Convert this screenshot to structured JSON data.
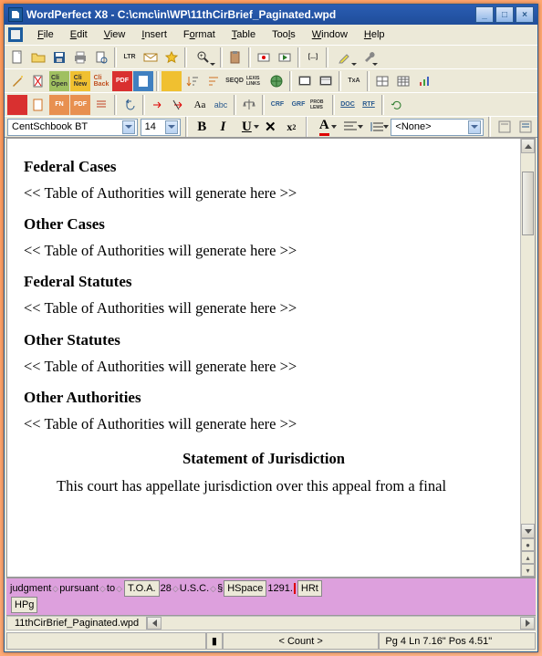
{
  "app": {
    "title": "WordPerfect X8 - C:\\cmc\\in\\WP\\11thCirBrief_Paginated.wpd"
  },
  "menu": {
    "file": "File",
    "edit": "Edit",
    "view": "View",
    "insert": "Insert",
    "format": "Format",
    "table": "Table",
    "tools": "Tools",
    "window": "Window",
    "help": "Help"
  },
  "prop": {
    "font": "CentSchbook BT",
    "size": "14",
    "style_none": "<None>"
  },
  "doc": {
    "h1": "Federal Cases",
    "p1": "<< Table of Authorities will generate here >>",
    "h2": "Other Cases",
    "p2": "<< Table of Authorities will generate here >>",
    "h3": "Federal Statutes",
    "p3": "<< Table of Authorities will generate here >>",
    "h4": "Other Statutes",
    "p4": "<< Table of Authorities will generate here >>",
    "h5": "Other Authorities",
    "p5": "<< Table of Authorities will generate here >>",
    "stmt": "Statement of Jurisdiction",
    "body": "This court has appellate jurisdiction over this appeal from a final"
  },
  "reveal": {
    "w1": "judgment",
    "w2": "pursuant",
    "w3": "to",
    "c1": "T.O.A.",
    "w4": "28",
    "w5": "U.S.C.",
    "w6": "§",
    "c2": "HSpace",
    "w7": "1291.",
    "c3": "HRt",
    "c4": "HPg"
  },
  "tab": {
    "doc": "11thCirBrief_Paginated.wpd"
  },
  "status": {
    "count": "< Count >",
    "pos": "Pg 4 Ln 7.16\" Pos 4.51\""
  },
  "icons": {
    "ltr": "LTR",
    "pdf": "PDF",
    "abc": "abc",
    "open": "Open",
    "new": "New",
    "back": "Back",
    "seqd": "SEQD",
    "lexis": "LEXIS LINKS",
    "txa": "TxA",
    "prob": "PROB LEMS",
    "doc2": "DOC",
    "rtf": "RTF",
    "brackets": "[...]"
  }
}
